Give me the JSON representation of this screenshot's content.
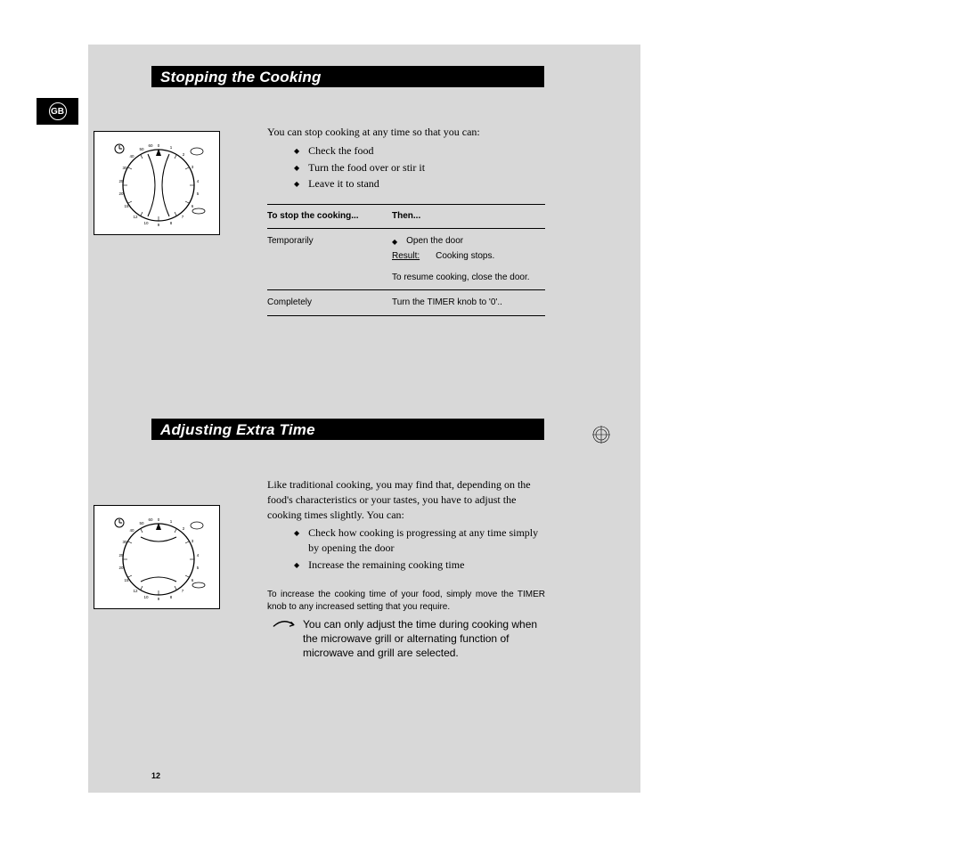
{
  "region_badge": "GB",
  "page_number": "12",
  "section1": {
    "heading": "Stopping the Cooking",
    "intro": "You can stop cooking at any time so that you can:",
    "bullets": [
      "Check the food",
      "Turn the food over or stir it",
      "Leave it to stand"
    ],
    "table": {
      "head_col1": "To stop the cooking...",
      "head_col2": "Then...",
      "row1_col1": "Temporarily",
      "row1_bullet": "Open the door",
      "row1_result_label": "Result:",
      "row1_result_text": "Cooking stops.",
      "row1_resume": "To resume cooking, close the door.",
      "row2_col1": "Completely",
      "row2_col2": "Turn the TIMER knob to '0'.."
    }
  },
  "section2": {
    "heading": "Adjusting Extra Time",
    "intro": "Like traditional cooking, you may find that, depending on the food's characteristics or your tastes, you have to adjust the cooking times slightly. You can:",
    "bullets": [
      "Check how cooking is progressing at any time simply by opening the door",
      "Increase the remaining cooking time"
    ],
    "tip": "To increase the cooking time of your food, simply move the TIMER knob to any increased setting that you require.",
    "note": "You can only adjust the time during cooking when the microwave grill or alternating function of microwave and grill are selected."
  },
  "dial": {
    "ticks": [
      "0",
      "1",
      "2",
      "3",
      "4",
      "5",
      "6",
      "7",
      "8",
      "9",
      "10",
      "12",
      "15",
      "20",
      "25",
      "30",
      "40",
      "50",
      "60"
    ]
  }
}
